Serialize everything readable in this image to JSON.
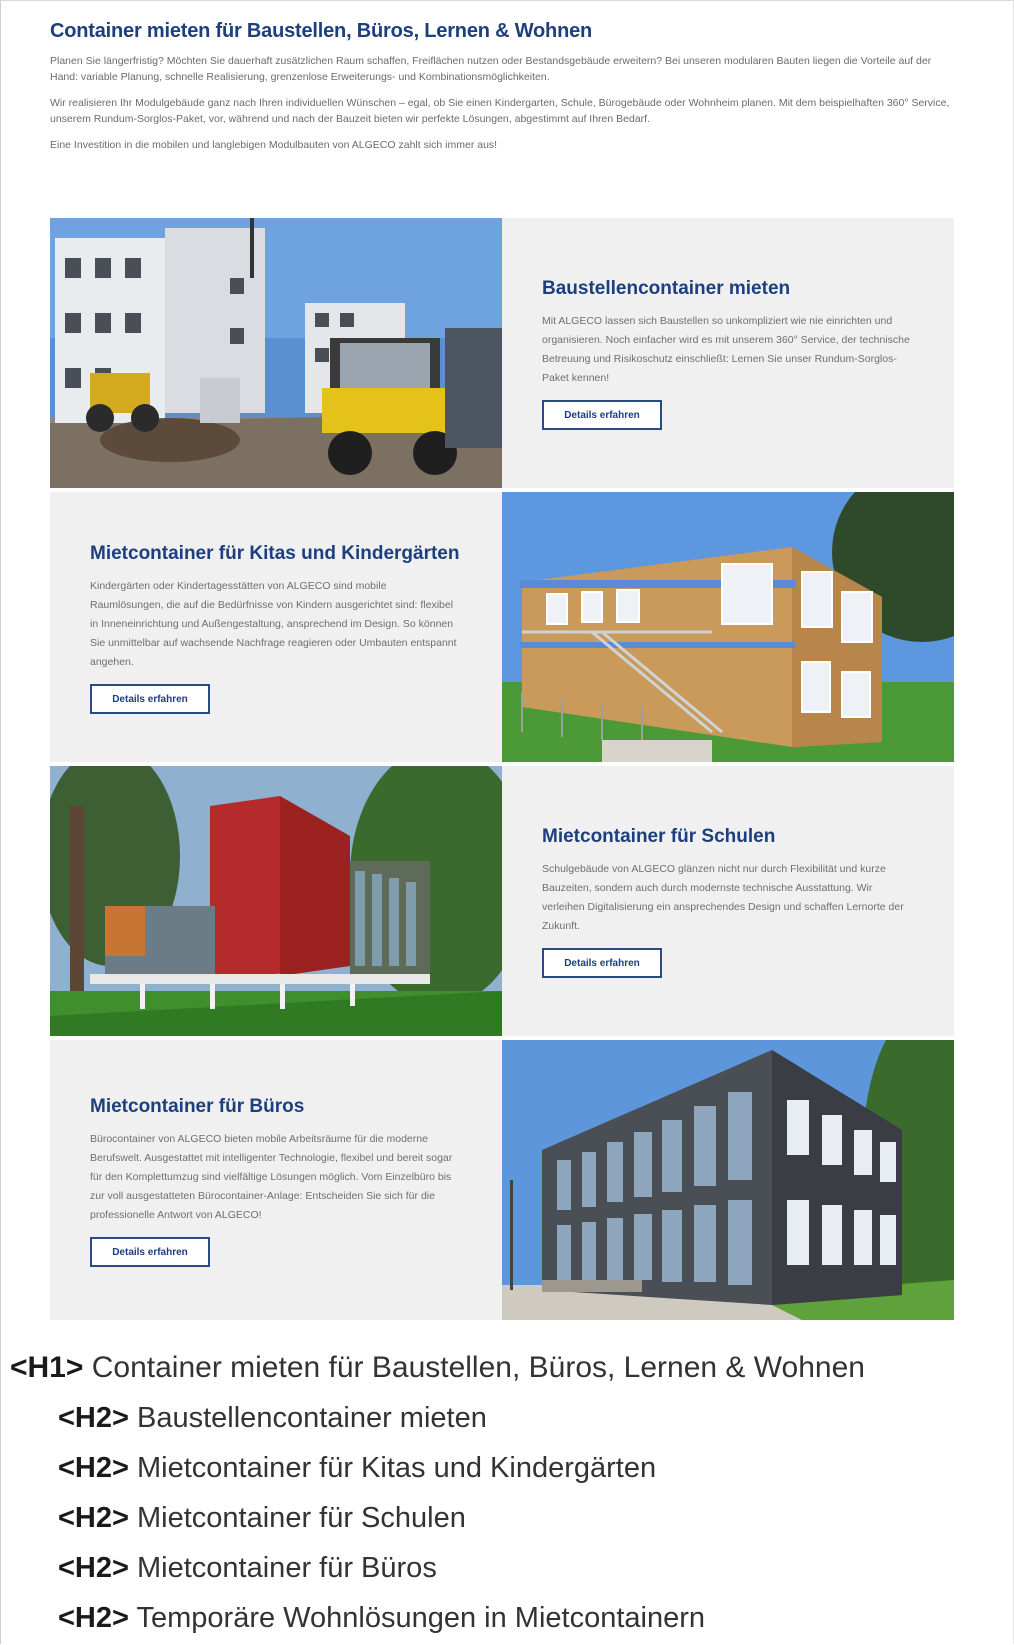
{
  "page": {
    "title": "Container mieten für Baustellen, Büros, Lernen & Wohnen",
    "paragraphs": [
      "Planen Sie längerfristig? Möchten Sie dauerhaft zusätzlichen Raum schaffen, Freiflächen nutzen oder Bestandsgebäude erweitern? Bei unseren modularen Bauten liegen die Vorteile auf der Hand: variable Planung, schnelle Realisierung, grenzenlose Erweiterungs- und Kombinationsmöglichkeiten.",
      "Wir realisieren Ihr Modulgebäude ganz nach Ihren individuellen Wünschen – egal, ob Sie einen Kindergarten, Schule, Bürogebäude oder Wohnheim planen. Mit dem beispielhaften 360° Service, unserem Rundum-Sorglos-Paket, vor, während und nach der Bauzeit bieten wir perfekte Lösungen, abgestimmt auf Ihren Bedarf.",
      "Eine Investition in die mobilen und langlebigen Modulbauten von ALGECO zahlt sich immer aus!"
    ]
  },
  "cards": [
    {
      "heading": "Baustellencontainer mieten",
      "text": "Mit ALGECO lassen sich Baustellen so unkompliziert wie nie einrichten und organisieren. Noch einfacher wird es mit unserem 360° Service, der technische Betreuung und Risikoschutz einschließt: Lernen Sie unser Rundum-Sorglos-Paket kennen!",
      "button": "Details erfahren"
    },
    {
      "heading": "Mietcontainer für Kitas und Kindergärten",
      "text": "Kindergärten oder Kindertagesstätten von ALGECO sind mobile Raumlösungen, die auf die Bedürfnisse von Kindern ausgerichtet sind: flexibel in Inneneinrichtung und Außengestaltung, ansprechend im Design. So können Sie unmittelbar auf wachsende Nachfrage reagieren oder Umbauten entspannt angehen.",
      "button": "Details erfahren"
    },
    {
      "heading": "Mietcontainer für Schulen",
      "text": "Schulgebäude von ALGECO glänzen nicht nur durch Flexibilität und kurze Bauzeiten, sondern auch durch modernste technische Ausstattung. Wir verleihen Digitalisierung ein ansprechendes Design und schaffen Lernorte der Zukunft.",
      "button": "Details erfahren"
    },
    {
      "heading": "Mietcontainer für Büros",
      "text": "Bürocontainer von ALGECO bieten mobile Arbeitsräume für die moderne Berufswelt. Ausgestattet mit intelligenter Technologie, flexibel und bereit sogar für den Komplettumzug sind vielfältige Lösungen möglich. Vom Einzelbüro bis zur voll ausgestatteten Bürocontainer-Anlage: Entscheiden Sie sich für die professionelle Antwort von ALGECO!",
      "button": "Details erfahren"
    }
  ],
  "outline": {
    "h1_tag": "<H1>",
    "h2_tag": "<H2>",
    "h1": "Container mieten für Baustellen, Büros, Lernen & Wohnen",
    "h2": [
      "Baustellencontainer mieten",
      "Mietcontainer für Kitas und Kindergärten",
      "Mietcontainer für Schulen",
      "Mietcontainer für Büros",
      "Temporäre Wohnlösungen in Mietcontainern"
    ]
  }
}
